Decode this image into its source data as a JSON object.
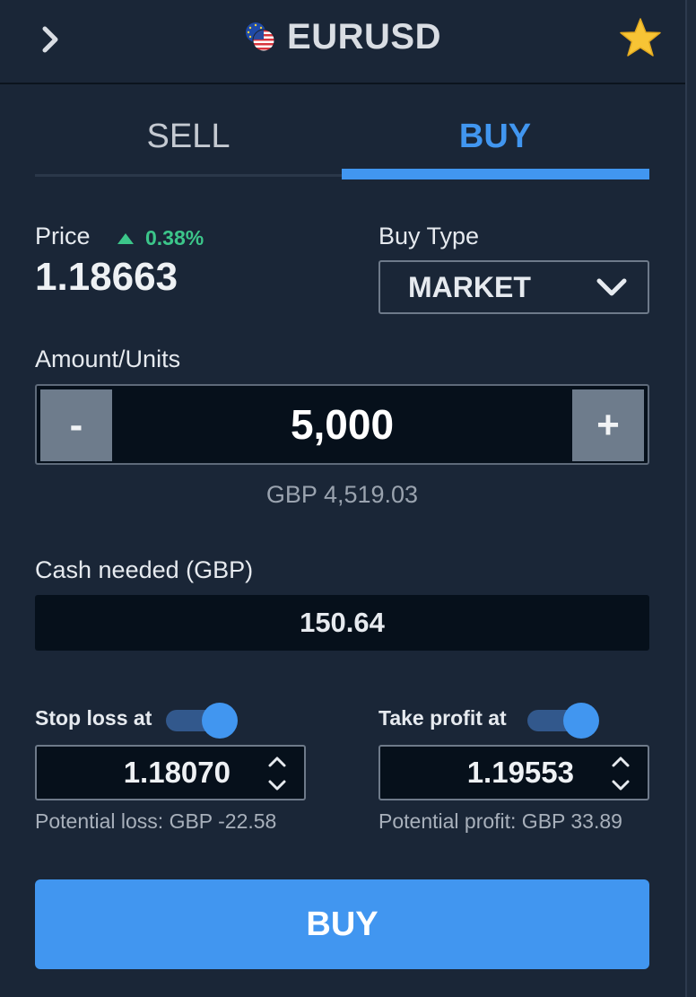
{
  "header": {
    "title": "EURUSD",
    "back_icon": "chevron-right-icon",
    "flag_icon": "eu-us-flag-icon",
    "favorite_icon": "star-icon",
    "star_color": "#f7c435"
  },
  "tabs": [
    {
      "label": "SELL",
      "active": false
    },
    {
      "label": "BUY",
      "active": true
    }
  ],
  "price": {
    "label": "Price",
    "change": "0.38%",
    "change_direction": "up",
    "value": "1.18663"
  },
  "buy_type": {
    "label": "Buy Type",
    "value": "MARKET"
  },
  "amount": {
    "label": "Amount/Units",
    "minus_label": "-",
    "plus_label": "+",
    "value": "5,000",
    "gbp_value": "GBP 4,519.03"
  },
  "cash_needed": {
    "label": "Cash needed (GBP)",
    "value": "150.64"
  },
  "stop_loss": {
    "label": "Stop loss at",
    "enabled": true,
    "value": "1.18070",
    "potential": "Potential loss: GBP -22.58"
  },
  "take_profit": {
    "label": "Take profit at",
    "enabled": true,
    "value": "1.19553",
    "potential": "Potential profit: GBP 33.89"
  },
  "submit": {
    "label": "BUY"
  },
  "colors": {
    "background": "#1a2637",
    "accent": "#4196f0",
    "positive": "#3cc68a",
    "input_bg": "#06101b"
  }
}
